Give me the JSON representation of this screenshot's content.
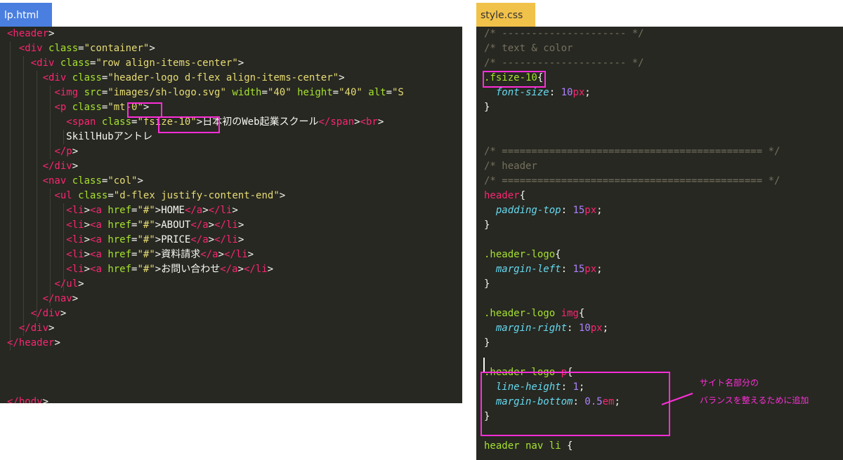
{
  "tabs": {
    "left": "lp.html",
    "right": "style.css"
  },
  "html_lines": [
    [
      [
        "t",
        "<header"
      ],
      [
        "p",
        ">"
      ]
    ],
    [
      [
        "p",
        "  "
      ],
      [
        "t",
        "<div"
      ],
      [
        "p",
        " "
      ],
      [
        "a",
        "class"
      ],
      [
        "p",
        "="
      ],
      [
        "s",
        "\"container\""
      ],
      [
        "p",
        ">"
      ]
    ],
    [
      [
        "p",
        "    "
      ],
      [
        "t",
        "<div"
      ],
      [
        "p",
        " "
      ],
      [
        "a",
        "class"
      ],
      [
        "p",
        "="
      ],
      [
        "s",
        "\"row align-items-center\""
      ],
      [
        "p",
        ">"
      ]
    ],
    [
      [
        "p",
        "      "
      ],
      [
        "t",
        "<div"
      ],
      [
        "p",
        " "
      ],
      [
        "a",
        "class"
      ],
      [
        "p",
        "="
      ],
      [
        "s",
        "\"header-logo d-flex align-items-center\""
      ],
      [
        "p",
        ">"
      ]
    ],
    [
      [
        "p",
        "        "
      ],
      [
        "t",
        "<img"
      ],
      [
        "p",
        " "
      ],
      [
        "a",
        "src"
      ],
      [
        "p",
        "="
      ],
      [
        "s",
        "\"images/sh-logo.svg\""
      ],
      [
        "p",
        " "
      ],
      [
        "a",
        "width"
      ],
      [
        "p",
        "="
      ],
      [
        "s",
        "\"40\""
      ],
      [
        "p",
        " "
      ],
      [
        "a",
        "height"
      ],
      [
        "p",
        "="
      ],
      [
        "s",
        "\"40\""
      ],
      [
        "p",
        " "
      ],
      [
        "a",
        "alt"
      ],
      [
        "p",
        "="
      ],
      [
        "s",
        "\"S"
      ]
    ],
    [
      [
        "p",
        "        "
      ],
      [
        "t",
        "<p"
      ],
      [
        "p",
        " "
      ],
      [
        "a",
        "class"
      ],
      [
        "p",
        "="
      ],
      [
        "s",
        "\"mt-0\""
      ],
      [
        "p",
        ">"
      ]
    ],
    [
      [
        "p",
        "          "
      ],
      [
        "t",
        "<span"
      ],
      [
        "p",
        " "
      ],
      [
        "a",
        "class"
      ],
      [
        "p",
        "="
      ],
      [
        "s",
        "\"fsize-10\""
      ],
      [
        "p",
        ">日本初のWeb起業スクール"
      ],
      [
        "t",
        "</span"
      ],
      [
        "p",
        ">"
      ],
      [
        "t",
        "<br"
      ],
      [
        "p",
        ">"
      ]
    ],
    [
      [
        "p",
        "          SkillHubアントレ"
      ]
    ],
    [
      [
        "p",
        "        "
      ],
      [
        "t",
        "</p"
      ],
      [
        "p",
        ">"
      ]
    ],
    [
      [
        "p",
        "      "
      ],
      [
        "t",
        "</div"
      ],
      [
        "p",
        ">"
      ]
    ],
    [
      [
        "p",
        "      "
      ],
      [
        "t",
        "<nav"
      ],
      [
        "p",
        " "
      ],
      [
        "a",
        "class"
      ],
      [
        "p",
        "="
      ],
      [
        "s",
        "\"col\""
      ],
      [
        "p",
        ">"
      ]
    ],
    [
      [
        "p",
        "        "
      ],
      [
        "t",
        "<ul"
      ],
      [
        "p",
        " "
      ],
      [
        "a",
        "class"
      ],
      [
        "p",
        "="
      ],
      [
        "s",
        "\"d-flex justify-content-end\""
      ],
      [
        "p",
        ">"
      ]
    ],
    [
      [
        "p",
        "          "
      ],
      [
        "t",
        "<li"
      ],
      [
        "p",
        ">"
      ],
      [
        "t",
        "<a"
      ],
      [
        "p",
        " "
      ],
      [
        "a",
        "href"
      ],
      [
        "p",
        "="
      ],
      [
        "s",
        "\"#\""
      ],
      [
        "p",
        ">HOME"
      ],
      [
        "t",
        "</a"
      ],
      [
        "p",
        ">"
      ],
      [
        "t",
        "</li"
      ],
      [
        "p",
        ">"
      ]
    ],
    [
      [
        "p",
        "          "
      ],
      [
        "t",
        "<li"
      ],
      [
        "p",
        ">"
      ],
      [
        "t",
        "<a"
      ],
      [
        "p",
        " "
      ],
      [
        "a",
        "href"
      ],
      [
        "p",
        "="
      ],
      [
        "s",
        "\"#\""
      ],
      [
        "p",
        ">ABOUT"
      ],
      [
        "t",
        "</a"
      ],
      [
        "p",
        ">"
      ],
      [
        "t",
        "</li"
      ],
      [
        "p",
        ">"
      ]
    ],
    [
      [
        "p",
        "          "
      ],
      [
        "t",
        "<li"
      ],
      [
        "p",
        ">"
      ],
      [
        "t",
        "<a"
      ],
      [
        "p",
        " "
      ],
      [
        "a",
        "href"
      ],
      [
        "p",
        "="
      ],
      [
        "s",
        "\"#\""
      ],
      [
        "p",
        ">PRICE"
      ],
      [
        "t",
        "</a"
      ],
      [
        "p",
        ">"
      ],
      [
        "t",
        "</li"
      ],
      [
        "p",
        ">"
      ]
    ],
    [
      [
        "p",
        "          "
      ],
      [
        "t",
        "<li"
      ],
      [
        "p",
        ">"
      ],
      [
        "t",
        "<a"
      ],
      [
        "p",
        " "
      ],
      [
        "a",
        "href"
      ],
      [
        "p",
        "="
      ],
      [
        "s",
        "\"#\""
      ],
      [
        "p",
        ">資料請求"
      ],
      [
        "t",
        "</a"
      ],
      [
        "p",
        ">"
      ],
      [
        "t",
        "</li"
      ],
      [
        "p",
        ">"
      ]
    ],
    [
      [
        "p",
        "          "
      ],
      [
        "t",
        "<li"
      ],
      [
        "p",
        ">"
      ],
      [
        "t",
        "<a"
      ],
      [
        "p",
        " "
      ],
      [
        "a",
        "href"
      ],
      [
        "p",
        "="
      ],
      [
        "s",
        "\"#\""
      ],
      [
        "p",
        ">お問い合わせ"
      ],
      [
        "t",
        "</a"
      ],
      [
        "p",
        ">"
      ],
      [
        "t",
        "</li"
      ],
      [
        "p",
        ">"
      ]
    ],
    [
      [
        "p",
        "        "
      ],
      [
        "t",
        "</ul"
      ],
      [
        "p",
        ">"
      ]
    ],
    [
      [
        "p",
        "      "
      ],
      [
        "t",
        "</nav"
      ],
      [
        "p",
        ">"
      ]
    ],
    [
      [
        "p",
        "    "
      ],
      [
        "t",
        "</div"
      ],
      [
        "p",
        ">"
      ]
    ],
    [
      [
        "p",
        "  "
      ],
      [
        "t",
        "</div"
      ],
      [
        "p",
        ">"
      ]
    ],
    [
      [
        "t",
        "</header"
      ],
      [
        "p",
        ">"
      ]
    ],
    [],
    [],
    [],
    [
      [
        "t",
        "</body"
      ],
      [
        "p",
        ">"
      ]
    ]
  ],
  "css_lines": [
    [
      [
        "c",
        "/* --------------------- */"
      ]
    ],
    [
      [
        "c",
        "/* text & color"
      ]
    ],
    [
      [
        "c",
        "/* --------------------- */"
      ]
    ],
    [
      [
        "a",
        ".fsize-10"
      ],
      [
        "p",
        "{"
      ]
    ],
    [
      [
        "p",
        "  "
      ],
      [
        "k",
        "font-size"
      ],
      [
        "p",
        ": "
      ],
      [
        "n",
        "10"
      ],
      [
        "u",
        "px"
      ],
      [
        "p",
        ";"
      ]
    ],
    [
      [
        "p",
        "}"
      ]
    ],
    [],
    [],
    [
      [
        "c",
        "/* ============================================ */"
      ]
    ],
    [
      [
        "c",
        "/* header"
      ]
    ],
    [
      [
        "c",
        "/* ============================================ */"
      ]
    ],
    [
      [
        "t",
        "header"
      ],
      [
        "p",
        "{"
      ]
    ],
    [
      [
        "p",
        "  "
      ],
      [
        "k",
        "padding-top"
      ],
      [
        "p",
        ": "
      ],
      [
        "n",
        "15"
      ],
      [
        "u",
        "px"
      ],
      [
        "p",
        ";"
      ]
    ],
    [
      [
        "p",
        "}"
      ]
    ],
    [],
    [
      [
        "a",
        ".header-logo"
      ],
      [
        "p",
        "{"
      ]
    ],
    [
      [
        "p",
        "  "
      ],
      [
        "k",
        "margin-left"
      ],
      [
        "p",
        ": "
      ],
      [
        "n",
        "15"
      ],
      [
        "u",
        "px"
      ],
      [
        "p",
        ";"
      ]
    ],
    [
      [
        "p",
        "}"
      ]
    ],
    [],
    [
      [
        "a",
        ".header-logo "
      ],
      [
        "t",
        "img"
      ],
      [
        "p",
        "{"
      ]
    ],
    [
      [
        "p",
        "  "
      ],
      [
        "k",
        "margin-right"
      ],
      [
        "p",
        ": "
      ],
      [
        "n",
        "10"
      ],
      [
        "u",
        "px"
      ],
      [
        "p",
        ";"
      ]
    ],
    [
      [
        "p",
        "}"
      ]
    ],
    [],
    [
      [
        "a",
        ".header-logo "
      ],
      [
        "t",
        "p"
      ],
      [
        "p",
        "{"
      ]
    ],
    [
      [
        "p",
        "  "
      ],
      [
        "k",
        "line-height"
      ],
      [
        "p",
        ": "
      ],
      [
        "n",
        "1"
      ],
      [
        "p",
        ";"
      ]
    ],
    [
      [
        "p",
        "  "
      ],
      [
        "k",
        "margin-bottom"
      ],
      [
        "p",
        ": "
      ],
      [
        "n",
        "0.5"
      ],
      [
        "u",
        "em"
      ],
      [
        "p",
        ";"
      ]
    ],
    [
      [
        "p",
        "}"
      ]
    ],
    [],
    [
      [
        "a",
        "header nav li "
      ],
      [
        "p",
        "{"
      ]
    ]
  ],
  "annotation": {
    "line1": "サイト名部分の",
    "line2": "バランスを整えるために追加"
  },
  "colors": {
    "highlight": "#ff2ed8",
    "editor_bg": "#272822",
    "tab_html": "#4a7fe0",
    "tab_css": "#f1c24a"
  }
}
